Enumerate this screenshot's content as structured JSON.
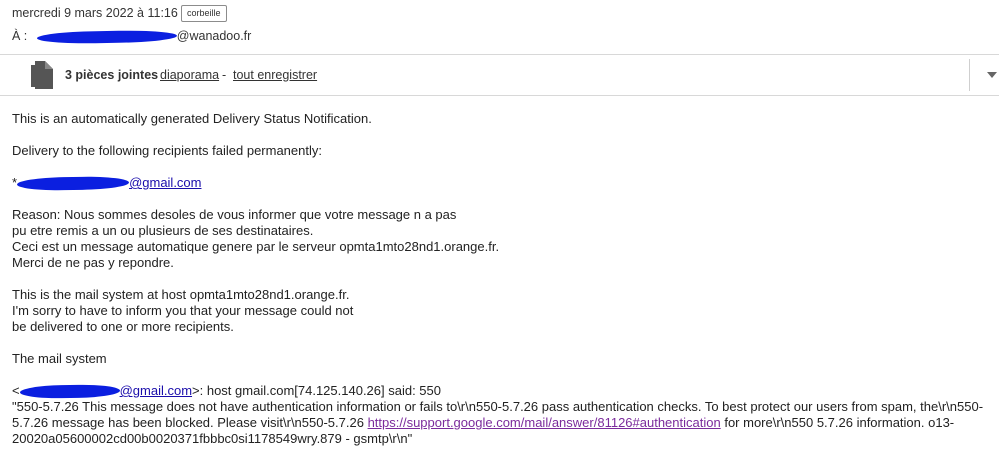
{
  "header": {
    "date": "mercredi 9 mars 2022 à 11:16",
    "folder_tag": "corbeille",
    "to_label": "À :",
    "to_domain": "@wanadoo.fr"
  },
  "attachments": {
    "count_label": "3 pièces jointes",
    "slideshow_link": "diaporama",
    "separator": "-",
    "save_all_link": "tout enregistrer",
    "icons": [
      "document-icon",
      "chevron-down-icon"
    ]
  },
  "body": {
    "line1": "This is an automatically generated Delivery Status Notification.",
    "line2": "Delivery to the following recipients failed permanently:",
    "recipient_prefix": "*",
    "recipient_domain": "@gmail.com",
    "reason": [
      "Reason: Nous sommes desoles de vous informer que votre message n a pas",
      "pu etre remis a un ou plusieurs de ses destinataires.",
      "Ceci est un message automatique genere par le serveur opmta1mto28nd1.orange.fr.",
      "Merci de ne pas y repondre."
    ],
    "mail_system": [
      "This is the mail system at host opmta1mto28nd1.orange.fr.",
      "I'm sorry to have to inform you that your message could not",
      "be delivered to one or more recipients."
    ],
    "signoff": "The mail system",
    "diag_open": "<",
    "diag_domain": "@gmail.com",
    "diag_rest": ">: host gmail.com[74.125.140.26] said: 550",
    "diag_text1": "\"550-5.7.26 This message does not have authentication information or fails to\\r\\n550-5.7.26 pass authentication checks. To best protect our users from spam, the\\r\\n550-5.7.26 message has been blocked. Please visit\\r\\n550-5.7.26 ",
    "diag_link": "https://support.google.com/mail/answer/81126#authentication",
    "diag_text2": " for more\\r\\n550 5.7.26 information. o13-20020a05600002cd00b0020371fbbbc0si1178549wry.879 - gsmtp\\r\\n\""
  },
  "colors": {
    "redaction": "#0b1fe0",
    "link": "#1a0dab",
    "visited_link": "#7b2b9c"
  }
}
